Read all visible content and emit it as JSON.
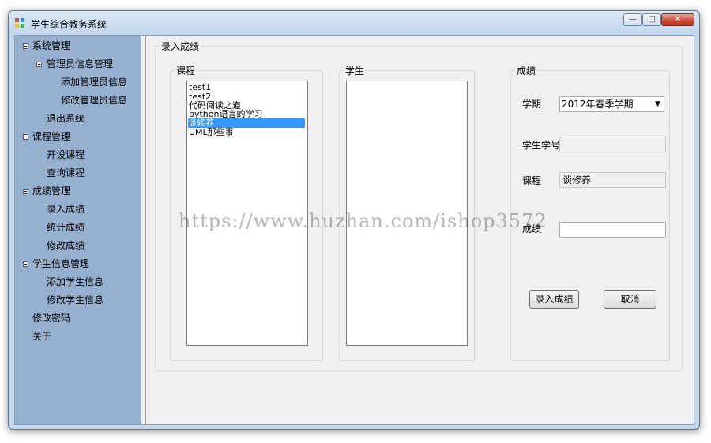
{
  "window": {
    "title": "学生综合教务系统",
    "controls": {
      "min": "—",
      "max": "□",
      "close": "✕"
    }
  },
  "sidebar": {
    "items": [
      {
        "label": "系统管理",
        "level": 0,
        "expanded": true
      },
      {
        "label": "管理员信息管理",
        "level": 1,
        "expanded": true
      },
      {
        "label": "添加管理员信息",
        "level": 2
      },
      {
        "label": "修改管理员信息",
        "level": 2
      },
      {
        "label": "退出系统",
        "level": 1
      },
      {
        "label": "课程管理",
        "level": 0,
        "expanded": true
      },
      {
        "label": "开设课程",
        "level": 1
      },
      {
        "label": "查询课程",
        "level": 1
      },
      {
        "label": "成绩管理",
        "level": 0,
        "expanded": true
      },
      {
        "label": "录入成绩",
        "level": 1
      },
      {
        "label": "统计成绩",
        "level": 1
      },
      {
        "label": "修改成绩",
        "level": 1
      },
      {
        "label": "学生信息管理",
        "level": 0,
        "expanded": true
      },
      {
        "label": "添加学生信息",
        "level": 1
      },
      {
        "label": "修改学生信息",
        "level": 1
      },
      {
        "label": "修改密码",
        "level": 0
      },
      {
        "label": "关于",
        "level": 0
      }
    ]
  },
  "main": {
    "panel_title": "录入成绩",
    "course_group": {
      "title": "课程",
      "items": [
        "test1",
        "test2",
        "代码阅读之道",
        "python语言的学习",
        "谈修养",
        "UML那些事"
      ],
      "selected_index": 4
    },
    "student_group": {
      "title": "学生",
      "items": []
    },
    "score_group": {
      "title": "成绩",
      "term_label": "学期",
      "term_value": "2012年春季学期",
      "student_id_label": "学生学号",
      "student_id_value": "",
      "course_label": "课程",
      "course_value": "谈修养",
      "score_label": "成绩",
      "score_value": "",
      "submit_button": "录入成绩",
      "cancel_button": "取消"
    }
  },
  "watermark": "https://www.huzhan.com/ishop3572"
}
